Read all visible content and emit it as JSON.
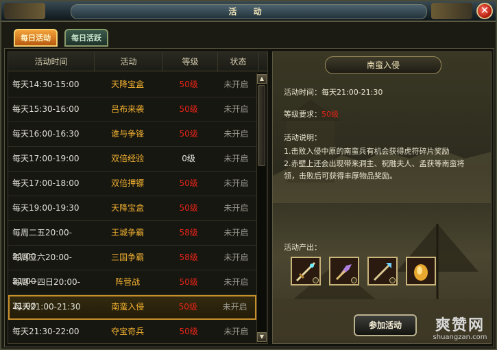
{
  "window": {
    "title": "活 动",
    "close_icon": "close-icon"
  },
  "tabs": [
    {
      "label": "每日活动",
      "active": true
    },
    {
      "label": "每日活跃",
      "active": false
    }
  ],
  "table": {
    "headers": [
      "活动时间",
      "活动",
      "等级",
      "状态"
    ],
    "rows": [
      {
        "time": "每天14:30-15:00",
        "name": "天降宝盒",
        "level": "50级",
        "status": "未开启"
      },
      {
        "time": "每天15:30-16:00",
        "name": "吕布来袭",
        "level": "50级",
        "status": "未开启"
      },
      {
        "time": "每天16:00-16:30",
        "name": "谁与争锋",
        "level": "50级",
        "status": "未开启"
      },
      {
        "time": "每天17:00-19:00",
        "name": "双倍经验",
        "level": "0级",
        "status": "未开启"
      },
      {
        "time": "每天17:00-18:00",
        "name": "双倍押镖",
        "level": "50级",
        "status": "未开启"
      },
      {
        "time": "每天19:00-19:30",
        "name": "天降宝盒",
        "level": "50级",
        "status": "未开启"
      },
      {
        "time": "每周二五20:00-21:00",
        "name": "王城争霸",
        "level": "58级",
        "status": "未开启"
      },
      {
        "time": "每周三六20:00-21:00",
        "name": "三国争霸",
        "level": "58级",
        "status": "未开启"
      },
      {
        "time": "每周一四日20:00-21:00",
        "name": "阵营战",
        "level": "50级",
        "status": "未开启"
      },
      {
        "time": "每天21:00-21:30",
        "name": "南蛮入侵",
        "level": "50级",
        "status": "未开启",
        "selected": true
      },
      {
        "time": "每天21:30-22:00",
        "name": "夺宝奇兵",
        "level": "50级",
        "status": "未开启"
      }
    ]
  },
  "detail": {
    "title": "南蛮入侵",
    "time_label": "活动时间：",
    "time_value": "每天21:00-21:30",
    "level_label": "等级要求：",
    "level_value": "50级",
    "desc_label": "活动说明：",
    "desc_lines": [
      "1.击败入侵中原的南蛮兵有机会获得虎符碎片奖励",
      "2.赤壁上还会出现带来洞主、祝融夫人、孟获等南蛮将",
      "领，击败后可获得丰厚物品奖励。"
    ],
    "drops_label": "活动产出：",
    "drops": [
      "weapon-sword-icon",
      "weapon-claw-icon",
      "weapon-staff-icon",
      "gold-ingot-icon"
    ],
    "join_label": "参加活动"
  },
  "watermark": {
    "main": "爽赞网",
    "sub": "shuangzan.com"
  },
  "colors": {
    "level_red": "#e62418",
    "activity_gold": "#f0b030",
    "status_gray": "#9a9a92",
    "selected_border": "#c8902a"
  }
}
